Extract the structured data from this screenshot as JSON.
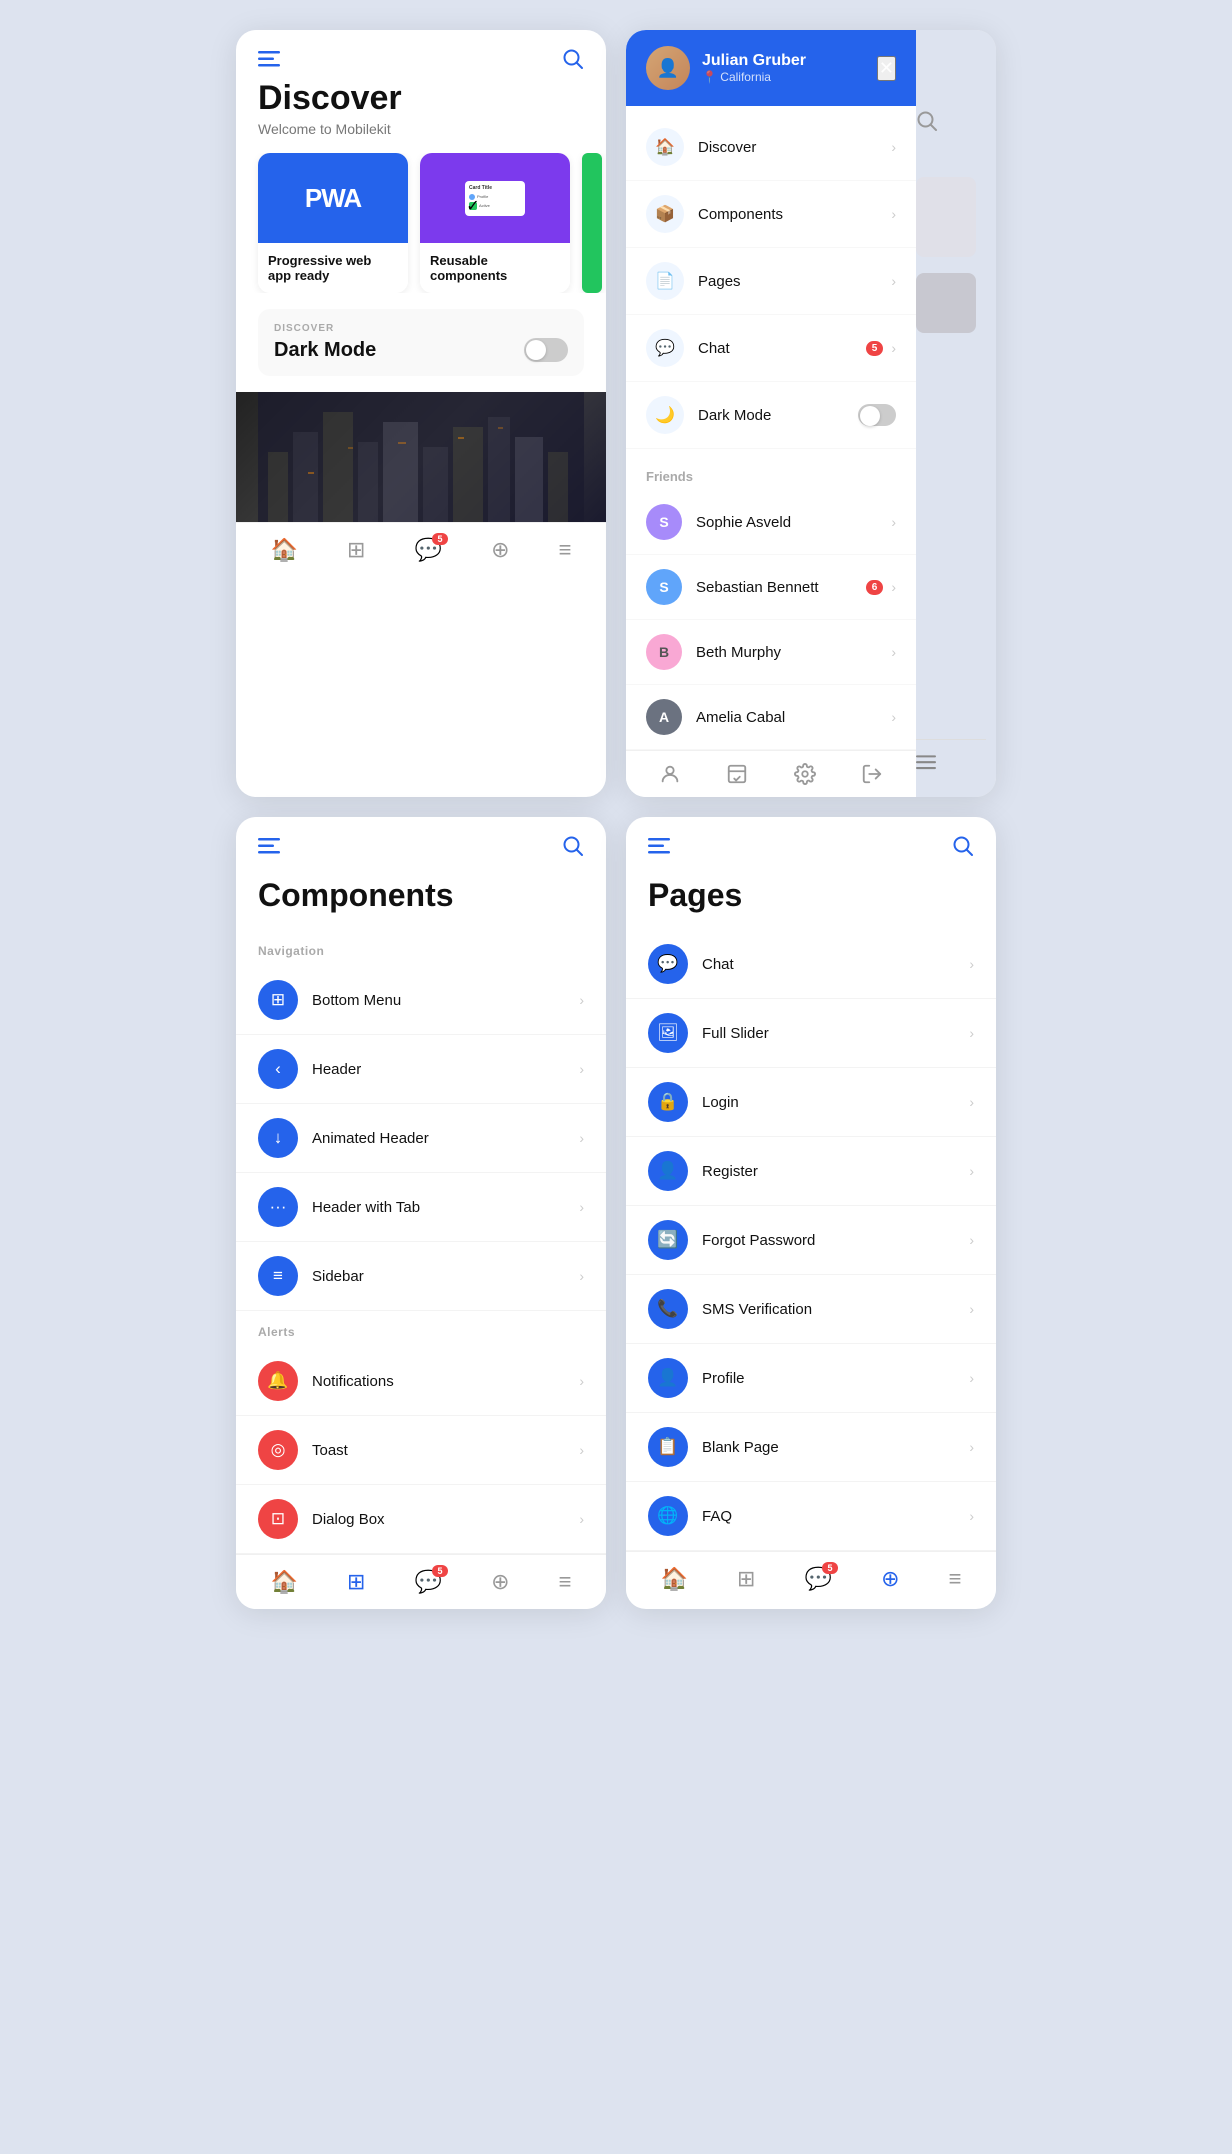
{
  "app": {
    "name": "Mobilekit"
  },
  "discover": {
    "title": "Discover",
    "subtitle": "Welcome to Mobilekit",
    "dark_mode_label": "DISCOVER",
    "dark_mode_title": "Dark Mode",
    "cards": [
      {
        "id": "pwa",
        "label": "Progressive web app ready",
        "type": "pwa"
      },
      {
        "id": "components",
        "label": "Reusable components",
        "type": "preview"
      }
    ]
  },
  "sidebar": {
    "user": {
      "name": "Julian Gruber",
      "location": "California"
    },
    "menu_items": [
      {
        "id": "discover",
        "label": "Discover",
        "icon": "🏠"
      },
      {
        "id": "components",
        "label": "Components",
        "icon": "📦"
      },
      {
        "id": "pages",
        "label": "Pages",
        "icon": "📄"
      },
      {
        "id": "chat",
        "label": "Chat",
        "icon": "💬",
        "badge": "5"
      },
      {
        "id": "dark_mode",
        "label": "Dark Mode",
        "icon": "🌙",
        "toggle": true
      }
    ],
    "friends_label": "Friends",
    "friends": [
      {
        "id": "sophie",
        "name": "Sophie Asveld",
        "color": "#a78bfa"
      },
      {
        "id": "sebastian",
        "name": "Sebastian Bennett",
        "color": "#60a5fa",
        "badge": "6"
      },
      {
        "id": "beth",
        "name": "Beth Murphy",
        "color": "#f9a8d4"
      },
      {
        "id": "amelia",
        "name": "Amelia Cabal",
        "color": "#6b7280"
      }
    ],
    "bottom_nav": [
      "profile",
      "inbox",
      "settings",
      "logout"
    ]
  },
  "components": {
    "title": "Components",
    "sections": [
      {
        "label": "Navigation",
        "items": [
          {
            "id": "bottom-menu",
            "label": "Bottom Menu",
            "color": "#2563eb",
            "icon": "⊞"
          },
          {
            "id": "header",
            "label": "Header",
            "color": "#2563eb",
            "icon": "‹"
          },
          {
            "id": "animated-header",
            "label": "Animated Header",
            "color": "#2563eb",
            "icon": "↓"
          },
          {
            "id": "header-with-tab",
            "label": "Header with Tab",
            "color": "#2563eb",
            "icon": "···"
          },
          {
            "id": "sidebar",
            "label": "Sidebar",
            "color": "#2563eb",
            "icon": "≡"
          }
        ]
      },
      {
        "label": "Alerts",
        "items": [
          {
            "id": "notifications",
            "label": "Notifications",
            "color": "#ef4444",
            "icon": "🔔"
          },
          {
            "id": "toast",
            "label": "Toast",
            "color": "#ef4444",
            "icon": "◎"
          },
          {
            "id": "dialog-box",
            "label": "Dialog Box",
            "color": "#ef4444",
            "icon": "⊡"
          }
        ]
      }
    ],
    "bottom_nav_active": "components"
  },
  "pages": {
    "title": "Pages",
    "items": [
      {
        "id": "chat",
        "label": "Chat",
        "icon": "💬"
      },
      {
        "id": "full-slider",
        "label": "Full Slider",
        "icon": "🖼"
      },
      {
        "id": "login",
        "label": "Login",
        "icon": "🔒"
      },
      {
        "id": "register",
        "label": "Register",
        "icon": "👤"
      },
      {
        "id": "forgot-password",
        "label": "Forgot Password",
        "icon": "🔄"
      },
      {
        "id": "sms-verification",
        "label": "SMS Verification",
        "icon": "📞"
      },
      {
        "id": "profile",
        "label": "Profile",
        "icon": "👤"
      },
      {
        "id": "blank-page",
        "label": "Blank Page",
        "icon": "📋"
      },
      {
        "id": "faq",
        "label": "FAQ",
        "icon": "🌐"
      }
    ],
    "bottom_nav_active": "pages"
  },
  "nav": {
    "home_label": "Home",
    "components_label": "Components",
    "chat_label": "Chat",
    "layers_label": "Layers",
    "menu_label": "Menu",
    "chat_badge": "5"
  },
  "colors": {
    "primary": "#2563eb",
    "danger": "#ef4444",
    "purple": "#7c3aed",
    "light_bg": "#eff6ff"
  }
}
